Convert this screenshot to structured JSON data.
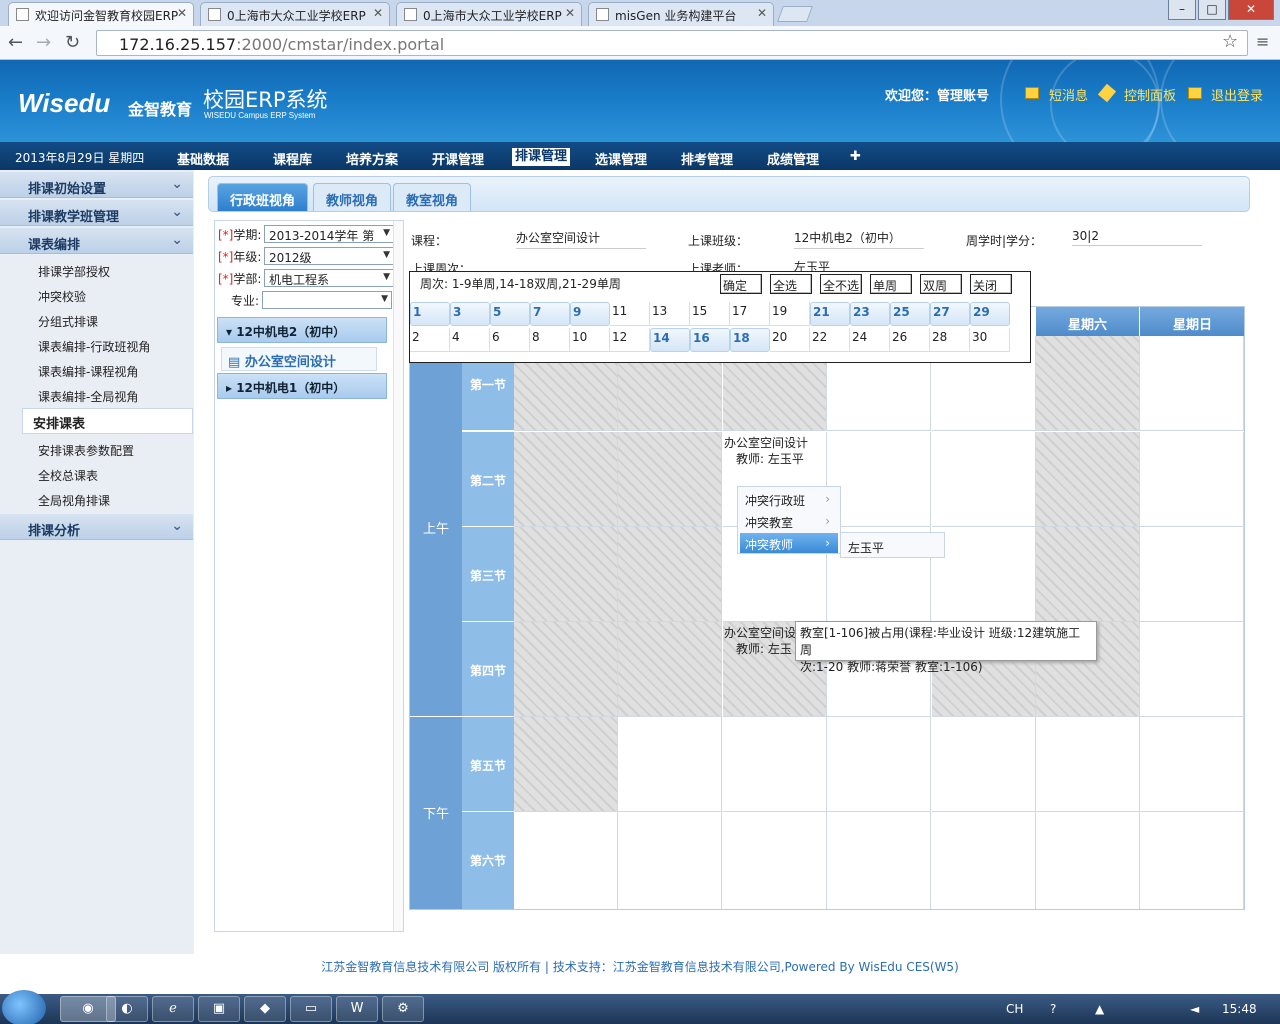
{
  "browser": {
    "tabs": [
      {
        "label": "欢迎访问金智教育校园ERP",
        "active": true
      },
      {
        "label": "0上海市大众工业学校ERP"
      },
      {
        "label": "0上海市大众工业学校ERP"
      },
      {
        "label": "misGen 业务构建平台"
      }
    ],
    "url_host": "172.16.25.157",
    "url_path": ":2000/cmstar/index.portal"
  },
  "header": {
    "logo": "Wisedu",
    "logo_cn": "金智教育",
    "system_name": "校园ERP系统",
    "system_name_en": "WISEDU Campus ERP System",
    "welcome": "欢迎您：管理账号",
    "links": {
      "messages": "短消息",
      "control_panel": "控制面板",
      "logout": "退出登录"
    }
  },
  "menubar": {
    "date": "2013年8月29日 星期四",
    "items": [
      "基础数据",
      "课程库",
      "培养方案",
      "开课管理",
      "排课管理",
      "选课管理",
      "排考管理",
      "成绩管理",
      "✚"
    ],
    "active": "排课管理"
  },
  "sidebar": {
    "sections": [
      "排课初始设置",
      "排课教学班管理",
      "课表编排",
      "排课分析"
    ],
    "items": [
      "排课学部授权",
      "冲突校验",
      "分组式排课",
      "课表编排-行政班视角",
      "课表编排-课程视角",
      "课表编排-全局视角",
      "安排课表",
      "安排课表参数配置",
      "全校总课表",
      "全局视角排课"
    ],
    "active": "安排课表"
  },
  "view_tabs": [
    "行政班视角",
    "教师视角",
    "教室视角"
  ],
  "filters": {
    "required_mark": "[*]",
    "term": {
      "label": "学期:",
      "value": "2013-2014学年 第"
    },
    "grade": {
      "label": "年级:",
      "value": "2012级"
    },
    "dept": {
      "label": "学部:",
      "value": "机电工程系"
    },
    "major": {
      "label": "专业:",
      "value": ""
    }
  },
  "tree": {
    "class1": "12中机电2（初中）",
    "course": "办公室空间设计",
    "class2": "12中机电1（初中）"
  },
  "info": {
    "course_label": "课程：",
    "course_value": "办公室空间设计",
    "class_label": "上课班级：",
    "class_value": "12中机电2（初中）",
    "hours_label": "周学时|学分：",
    "hours_value": "30|2",
    "weeks_label": "上课周次：",
    "teacher_label": "上课老师：",
    "teacher_value": "左玉平"
  },
  "week_popup": {
    "summary": "周次: 1-9单周,14-18双周,21-29单周",
    "buttons": [
      "确定",
      "全选",
      "全不选",
      "单周",
      "双周",
      "关闭"
    ],
    "row1": [
      {
        "w": "1",
        "on": true
      },
      {
        "w": "3",
        "on": true
      },
      {
        "w": "5",
        "on": true
      },
      {
        "w": "7",
        "on": true
      },
      {
        "w": "9",
        "on": true
      },
      {
        "w": "11",
        "on": false
      },
      {
        "w": "13",
        "on": false
      },
      {
        "w": "15",
        "on": false
      },
      {
        "w": "17",
        "on": false
      },
      {
        "w": "19",
        "on": false
      },
      {
        "w": "21",
        "on": true
      },
      {
        "w": "23",
        "on": true
      },
      {
        "w": "25",
        "on": true
      },
      {
        "w": "27",
        "on": true
      },
      {
        "w": "29",
        "on": true
      }
    ],
    "row2": [
      {
        "w": "2",
        "on": false
      },
      {
        "w": "4",
        "on": false
      },
      {
        "w": "6",
        "on": false
      },
      {
        "w": "8",
        "on": false
      },
      {
        "w": "10",
        "on": false
      },
      {
        "w": "12",
        "on": false
      },
      {
        "w": "14",
        "on": true
      },
      {
        "w": "16",
        "on": true
      },
      {
        "w": "18",
        "on": true
      },
      {
        "w": "20",
        "on": false
      },
      {
        "w": "22",
        "on": false
      },
      {
        "w": "24",
        "on": false
      },
      {
        "w": "26",
        "on": false
      },
      {
        "w": "28",
        "on": false
      },
      {
        "w": "30",
        "on": false
      }
    ]
  },
  "timetable": {
    "days_visible": [
      "星期六",
      "星期日"
    ],
    "halves": [
      "上午",
      "下午"
    ],
    "periods": [
      "第一节",
      "第二节",
      "第三节",
      "第四节",
      "第五节",
      "第六节"
    ],
    "entry2_course": "办公室空间设计",
    "entry2_teacher": "教师: 左玉平",
    "entry4_course": "办公室空间设",
    "entry4_teacher": "教师: 左玉"
  },
  "context_menu": {
    "items": [
      "冲突行政班",
      "冲突教室",
      "冲突教师"
    ],
    "highlighted": "冲突教师",
    "submenu_item": "左玉平"
  },
  "tooltip": {
    "line1": "教室[1-106]被占用(课程:毕业设计 班级:12建筑施工 周",
    "line2": "次:1-20 教师:蒋荣誉 教室:1-106)"
  },
  "footer": "江苏金智教育信息技术有限公司 版权所有 | 技术支持：江苏金智教育信息技术有限公司,Powered By WisEdu CES(W5)",
  "taskbar": {
    "tray_lang": "CH",
    "clock": "15:48"
  },
  "colors": {
    "header_blue": "#1a7dc9",
    "menu_blue": "#0b3766",
    "link_yellow": "#ffe560",
    "accent_blue": "#2b6db3"
  }
}
